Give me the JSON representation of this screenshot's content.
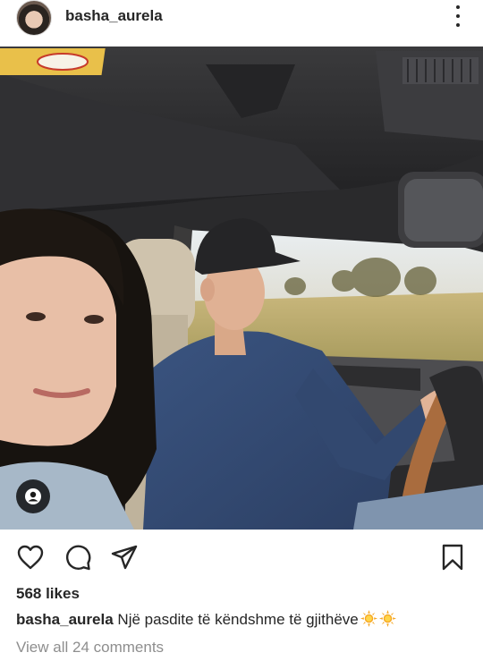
{
  "post": {
    "username": "basha_aurela",
    "avatar_icon": "profile-photo-icon",
    "more_icon": "more-vertical-icon"
  },
  "actions": {
    "like_icon": "heart-icon",
    "comment_icon": "comment-icon",
    "share_icon": "send-icon",
    "save_icon": "bookmark-icon",
    "tag_icon": "user-tag-icon"
  },
  "likes_text": "568 likes",
  "caption": {
    "username": "basha_aurela",
    "text": "Një pasdite të këndshme të gjithëve",
    "emoji": [
      "sun-emoji",
      "sun-emoji"
    ]
  },
  "comments_link": "View all 24 comments",
  "colors": {
    "text": "#262626",
    "secondary": "#8e8e8e",
    "background": "#ffffff"
  }
}
